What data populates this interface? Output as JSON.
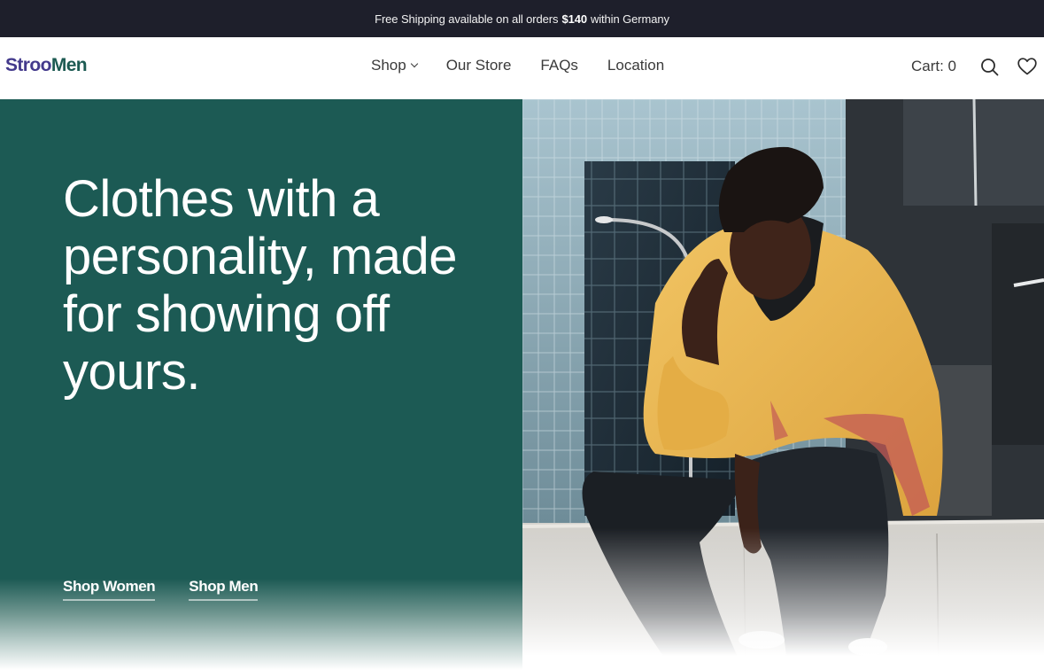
{
  "announcement": {
    "prefix": "Free Shipping available on all orders",
    "amount": "$140",
    "suffix": "within Germany"
  },
  "header": {
    "logo_part1": "Stroo",
    "logo_part2": "Men",
    "nav": [
      {
        "label": "Shop",
        "has_dropdown": true
      },
      {
        "label": "Our Store"
      },
      {
        "label": "FAQs"
      },
      {
        "label": "Location"
      }
    ],
    "cart_label": "Cart: 0",
    "icons": [
      "search-icon",
      "heart-icon"
    ]
  },
  "hero": {
    "headline": "Clothes with a personality, made for showing off yours.",
    "cta_women": "Shop Women",
    "cta_men": "Shop Men",
    "image_alt": "Man in yellow jacket sitting on concrete ledge in front of glass buildings"
  },
  "colors": {
    "announce_bg": "#1e1f2b",
    "hero_green": "#1c5a54",
    "logo_purple": "#433a8c",
    "logo_green": "#1c5a52",
    "jacket_yellow": "#eab54c"
  }
}
